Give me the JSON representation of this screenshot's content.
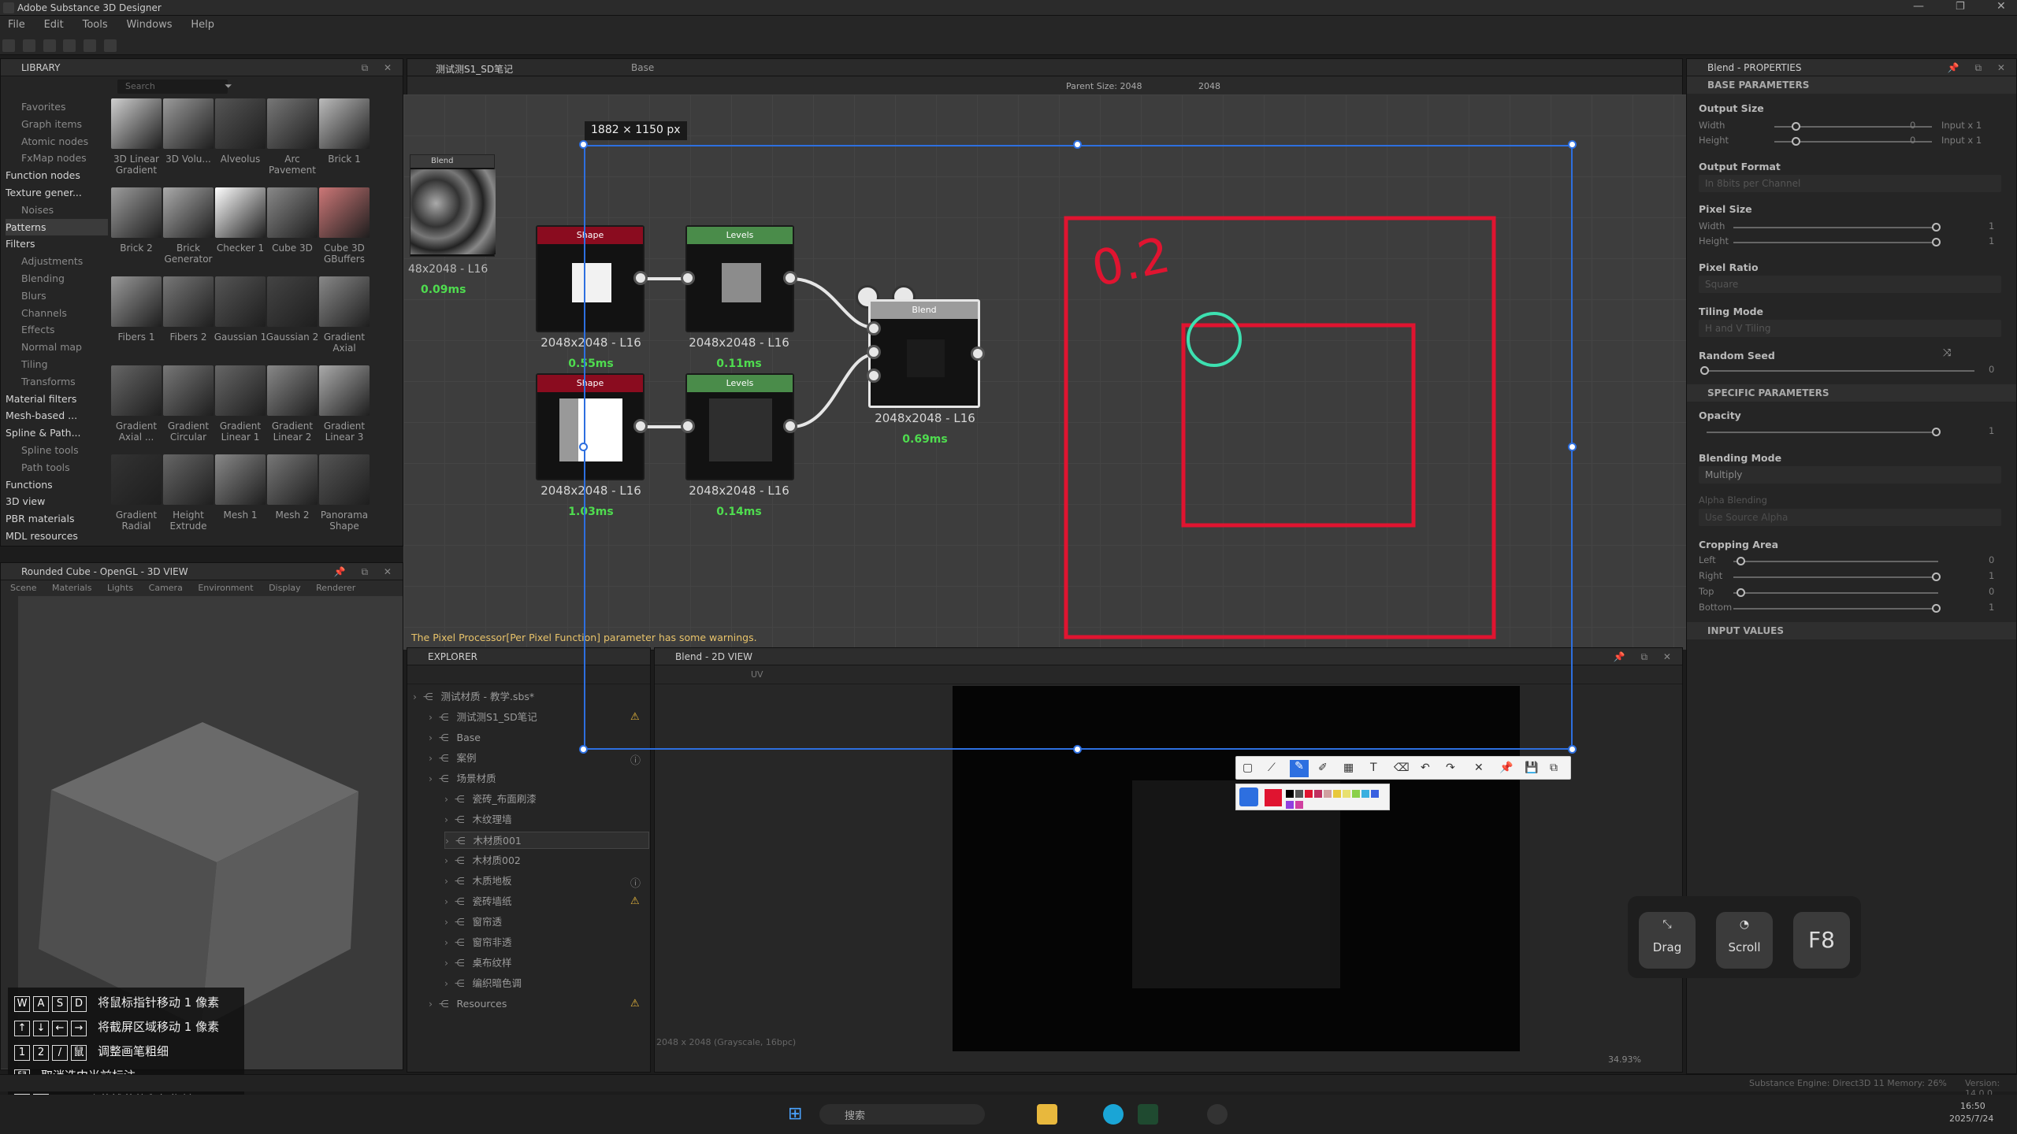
{
  "app": {
    "title": "Adobe Substance 3D Designer"
  },
  "menu": [
    "File",
    "Edit",
    "Tools",
    "Windows",
    "Help"
  ],
  "library": {
    "header": "LIBRARY",
    "search_placeholder": "Search",
    "categories": [
      {
        "label": "Favorites",
        "kind": "sub"
      },
      {
        "label": "Graph items",
        "kind": "sub"
      },
      {
        "label": "Atomic nodes",
        "kind": "sub"
      },
      {
        "label": "FxMap nodes",
        "kind": "sub"
      },
      {
        "label": "Function nodes",
        "kind": "b"
      },
      {
        "label": "Texture gener...",
        "kind": "b"
      },
      {
        "label": "Noises",
        "kind": "sub"
      },
      {
        "label": "Patterns",
        "kind": "sel"
      },
      {
        "label": "Filters",
        "kind": "b"
      },
      {
        "label": "Adjustments",
        "kind": "sub"
      },
      {
        "label": "Blending",
        "kind": "sub"
      },
      {
        "label": "Blurs",
        "kind": "sub"
      },
      {
        "label": "Channels",
        "kind": "sub"
      },
      {
        "label": "Effects",
        "kind": "sub"
      },
      {
        "label": "Normal map",
        "kind": "sub"
      },
      {
        "label": "Tiling",
        "kind": "sub"
      },
      {
        "label": "Transforms",
        "kind": "sub"
      },
      {
        "label": "Material filters",
        "kind": "b"
      },
      {
        "label": "Mesh-based ...",
        "kind": "b"
      },
      {
        "label": "Spline & Path...",
        "kind": "b"
      },
      {
        "label": "Spline tools",
        "kind": "sub"
      },
      {
        "label": "Path tools",
        "kind": "sub"
      },
      {
        "label": "Functions",
        "kind": "b"
      },
      {
        "label": "3D view",
        "kind": "b"
      },
      {
        "label": "PBR materials",
        "kind": "b"
      },
      {
        "label": "MDL resources",
        "kind": "b"
      }
    ],
    "thumbs": [
      "3D Linear Gradient",
      "3D Volu...",
      "Alveolus",
      "Arc Pavement",
      "Brick 1",
      "Brick 2",
      "Brick Generator",
      "Checker 1",
      "Cube 3D",
      "Cube 3D GBuffers",
      "Fibers 1",
      "Fibers 2",
      "Gaussian 1",
      "Gaussian 2",
      "Gradient Axial",
      "Gradient Axial ...",
      "Gradient Circular",
      "Gradient Linear 1",
      "Gradient Linear 2",
      "Gradient Linear 3",
      "Gradient Radial",
      "Height Extrude",
      "Mesh 1",
      "Mesh 2",
      "Panorama Shape"
    ]
  },
  "view3d": {
    "header": "Rounded Cube - OpenGL - 3D VIEW",
    "menu": [
      "Scene",
      "Materials",
      "Lights",
      "Camera",
      "Environment",
      "Display",
      "Renderer"
    ]
  },
  "graph": {
    "tabs": [
      "测试测S1_SD笔记",
      "Base"
    ],
    "parent_size_label": "Parent Size: 2048",
    "size_w": "2048",
    "size_h": "2048",
    "dimension_tag": "1882 × 1150  px",
    "warning": "The Pixel Processor[Per Pixel Function] parameter has some warnings.",
    "preview_node": {
      "title": "Blend",
      "size": "48x2048 - L16",
      "time": "0.09ms"
    },
    "nodes": [
      {
        "title": "Shape",
        "size": "2048x2048 - L16",
        "time": "0.55ms"
      },
      {
        "title": "Levels",
        "size": "2048x2048 - L16",
        "time": "0.11ms"
      },
      {
        "title": "Shape",
        "size": "2048x2048 - L16",
        "time": "1.03ms"
      },
      {
        "title": "Levels",
        "size": "2048x2048 - L16",
        "time": "0.14ms"
      },
      {
        "title": "Blend",
        "size": "2048x2048 - L16",
        "time": "0.69ms"
      }
    ],
    "annotation_text": "0.2"
  },
  "explorer": {
    "header": "EXPLORER",
    "rows": [
      {
        "label": "测试材质 - 教学.sbs*",
        "indent": 0,
        "warn": false
      },
      {
        "label": "测试测S1_SD笔记",
        "indent": 1,
        "warn": true
      },
      {
        "label": "Base",
        "indent": 1,
        "warn": false
      },
      {
        "label": "案例",
        "indent": 1,
        "warn": false,
        "info": true
      },
      {
        "label": "场景材质",
        "indent": 1,
        "warn": false
      },
      {
        "label": "瓷砖_布面刷漆",
        "indent": 2,
        "warn": false
      },
      {
        "label": "木纹理墙",
        "indent": 2,
        "warn": false
      },
      {
        "label": "木材质001",
        "indent": 2,
        "warn": false,
        "sel": true
      },
      {
        "label": "木材质002",
        "indent": 2,
        "warn": false
      },
      {
        "label": "木质地板",
        "indent": 2,
        "warn": false,
        "info": true
      },
      {
        "label": "瓷砖墙纸",
        "indent": 2,
        "warn": true
      },
      {
        "label": "窗帘透",
        "indent": 2,
        "warn": false
      },
      {
        "label": "窗帘非透",
        "indent": 2,
        "warn": false
      },
      {
        "label": "桌布纹样",
        "indent": 2,
        "warn": false
      },
      {
        "label": "编织暗色调",
        "indent": 2,
        "warn": false
      },
      {
        "label": "Resources",
        "indent": 1,
        "warn": true
      }
    ]
  },
  "view2d": {
    "header": "Blend - 2D VIEW",
    "uv_label": "UV",
    "status": "2048 x 2048 (Grayscale, 16bpc)",
    "zoom": "34.93%"
  },
  "properties": {
    "header": "Blend - PROPERTIES",
    "base_section": "BASE PARAMETERS",
    "specific_section": "SPECIFIC PARAMETERS",
    "input_values": "INPUT VALUES",
    "output_size": "Output Size",
    "width": "Width",
    "height": "Height",
    "width_val": "0",
    "height_val": "0",
    "width_mode": "Input x 1",
    "height_mode": "Input x 1",
    "output_format": "Output Format",
    "output_format_val": "In 8bits per Channel",
    "pixel_size": "Pixel Size",
    "pixel_w_val": "1",
    "pixel_h_val": "1",
    "pixel_ratio": "Pixel Ratio",
    "pixel_ratio_val": "Square",
    "tiling_mode": "Tiling Mode",
    "tiling_mode_val": "H and V Tiling",
    "random_seed": "Random Seed",
    "random_seed_val": "0",
    "opacity": "Opacity",
    "opacity_val": "1",
    "blending_mode": "Blending Mode",
    "blending_mode_val": "Multiply",
    "alpha_blending": "Alpha Blending",
    "alpha_blending_val": "Use Source Alpha",
    "cropping_area": "Cropping Area",
    "left": "Left",
    "right": "Right",
    "top": "Top",
    "bottom": "Bottom",
    "left_val": "0",
    "right_val": "1",
    "top_val": "0",
    "bottom_val": "1"
  },
  "keys": {
    "drag": "Drag",
    "scroll": "Scroll",
    "f8": "F8"
  },
  "help": [
    {
      "keys": [
        "W",
        "A",
        "S",
        "D"
      ],
      "text": "将鼠标指针移动 1 像素"
    },
    {
      "keys": [
        "↑",
        "↓",
        "←",
        "→"
      ],
      "text": "将截屏区域移动 1 像素"
    },
    {
      "keys": [
        "1",
        "2",
        "/",
        "鼠"
      ],
      "text": "调整画笔粗细"
    },
    {
      "keys": [
        "鼠"
      ],
      "text": "取消选中当前标注"
    },
    {
      "keys": [
        "/",
        "鼠"
      ],
      "text": "显示/隐藏捕获的鼠标指针"
    }
  ],
  "statusbar": {
    "engine": "Substance Engine: Direct3D 11  Memory: 26%",
    "version": "Version: 14.0.0"
  },
  "taskbar": {
    "search": "搜索",
    "time": "16:50",
    "date": "2025/7/24"
  },
  "colors": {
    "accent": "#2d6fe0",
    "annotation": "#e01430",
    "cursor": "#3de0b0",
    "ok_time": "#4fdc4f"
  }
}
